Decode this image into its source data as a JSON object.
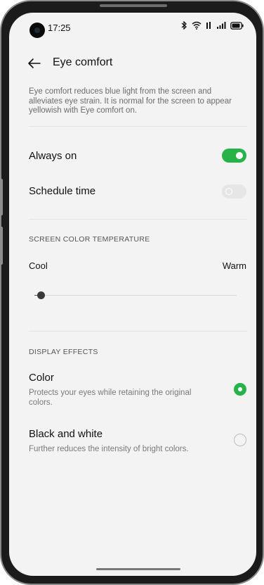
{
  "status_bar": {
    "time": "17:25",
    "icons": [
      "bluetooth-icon",
      "wifi-icon",
      "cellular-signal-icon",
      "battery-icon"
    ]
  },
  "header": {
    "back_icon": "arrow-left-icon",
    "title": "Eye comfort"
  },
  "description": "Eye comfort reduces blue light from the screen and alleviates eye strain. It is normal for the screen to appear yellowish with Eye comfort on.",
  "toggles": [
    {
      "label": "Always on",
      "state": "on"
    },
    {
      "label": "Schedule time",
      "state": "off"
    }
  ],
  "color_temperature": {
    "section_title": "SCREEN COLOR TEMPERATURE",
    "min_label": "Cool",
    "max_label": "Warm",
    "level": 0.03
  },
  "display_effects": {
    "section_title": "DISPLAY EFFECTS",
    "options": [
      {
        "title": "Color",
        "subtitle": "Protects your eyes while retaining the original colors.",
        "selected": true
      },
      {
        "title": "Black and white",
        "subtitle": "Further reduces the intensity of bright colors.",
        "selected": false
      }
    ]
  },
  "colors": {
    "accent": "#28b24a",
    "toggle_off": "#e6e6e6",
    "background": "#f3f3f3"
  }
}
